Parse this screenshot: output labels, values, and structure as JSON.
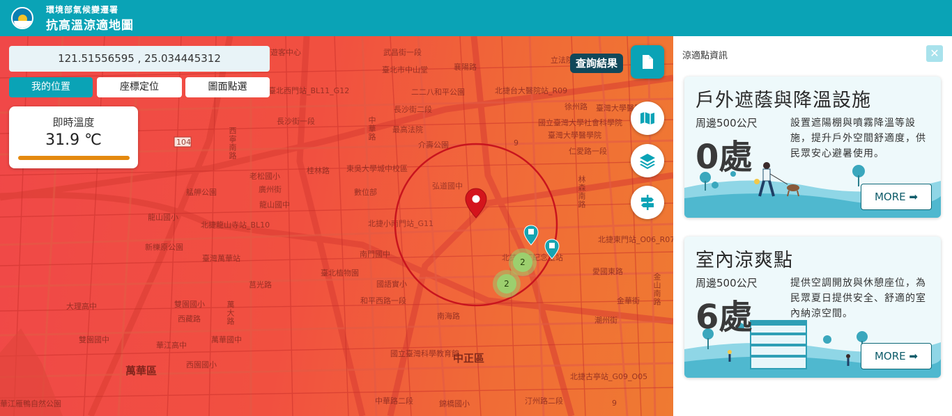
{
  "header": {
    "org_name": "環境部氣候變遷署",
    "app_title": "抗高溫涼適地圖"
  },
  "map": {
    "coordinates": "121.51556595 , 25.034445312",
    "locate_buttons": [
      "我的位置",
      "座標定位",
      "圖面點選"
    ],
    "temperature": {
      "label": "即時溫度",
      "value": "31.9 ℃"
    },
    "query_result_label": "查詢結果",
    "clusters": [
      "2",
      "2"
    ],
    "street_labels": [
      "西門町遊客中心",
      "武昌街一段",
      "臺北市中山堂",
      "襄陽路",
      "立法院",
      "臺北西門站_BL11_G12",
      "二二八和平公園",
      "北捷台大醫院站_R09",
      "臺灣大學醫學院",
      "長沙街一段",
      "長沙街二段",
      "最高法院",
      "國立臺灣大學社會科學院",
      "臺灣大學醫學院",
      "徐州路",
      "仁愛路一段",
      "介壽公園",
      "東吳大學城中校區",
      "桂林路",
      "老松國小",
      "廣州街",
      "艋舺公園",
      "龍山國中",
      "龍山國小",
      "北捷龍山寺站_BL10",
      "弘道國中",
      "北捷小南門站_G11",
      "數位部",
      "南門國中",
      "臺北植物園",
      "國語實小",
      "和平西路一段",
      "新櫟原公園",
      "臺灣萬華站",
      "莒光路",
      "大理高中",
      "雙園國小",
      "西藏路",
      "萬華國中",
      "華江高中",
      "雙園國中",
      "西園國小",
      "中華路二段",
      "錦橋國小",
      "汀州路二段",
      "北捷古亭站_G09_O05",
      "北捷東門站_O06_R07",
      "華江雁鴨自然公園",
      "林森南路",
      "金華街",
      "愛國東路",
      "潮州街",
      "金山南路",
      "北捷中正紀念堂站",
      "南海路",
      "萬大路",
      "國立臺灣科學教育館",
      "中正區",
      "萬華區",
      "西寧南路",
      "中華路"
    ],
    "road_numbers": [
      "104",
      "9",
      "9"
    ]
  },
  "panel": {
    "title": "涼適點資訊",
    "cards": [
      {
        "title": "戶外遮蔭與降溫設施",
        "radius_label": "周邊500公尺",
        "count": "0處",
        "description": "設置遮陽棚與噴霧降溫等設施，提升戶外空間舒適度，供民眾安心避暑使用。",
        "more_label": "MORE"
      },
      {
        "title": "室內涼爽點",
        "radius_label": "周邊500公尺",
        "count": "6處",
        "description": "提供空調開放與休憩座位，為民眾夏日提供安全、舒適的室內納涼空間。",
        "more_label": "MORE"
      }
    ]
  },
  "colors": {
    "header": "#0aa3b6",
    "map_heat": "#f04848",
    "temperature_bar": "#e4890f",
    "query_tag": "#10485a",
    "radius_circle": "#c8141e"
  }
}
